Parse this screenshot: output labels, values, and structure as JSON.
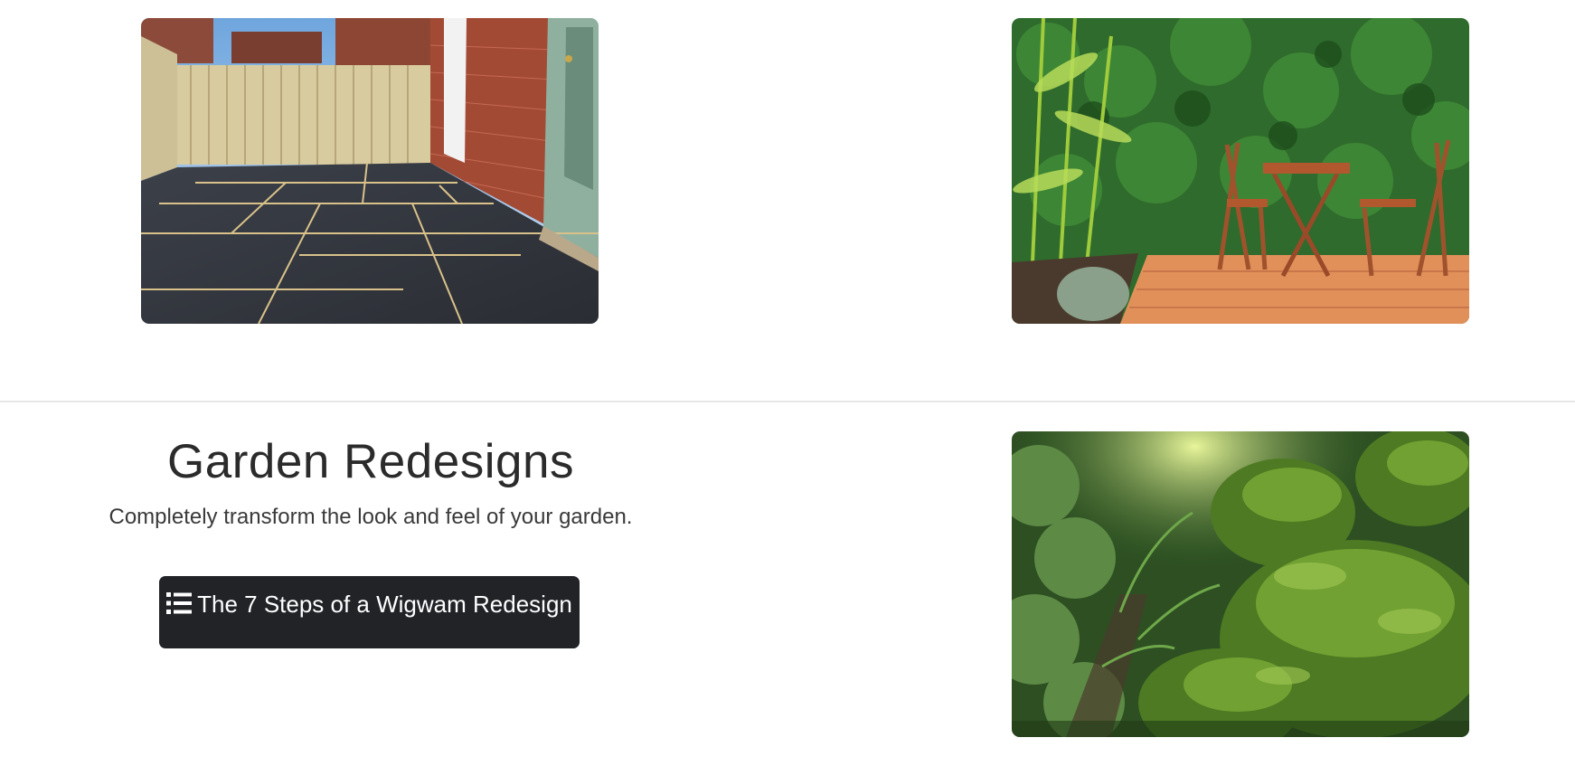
{
  "section": {
    "title": "Garden Redesigns",
    "subtitle": "Completely transform the look and feel of your garden.",
    "button_label": "The 7 Steps of a Wigwam Redesign",
    "button_icon": "list-icon"
  },
  "images": [
    {
      "name": "patio-image",
      "depicts": "patio-image"
    },
    {
      "name": "bistro-deck-image",
      "depicts": "bistro-deck-image"
    },
    {
      "name": "moss-garden-image",
      "depicts": "moss-garden-image"
    }
  ],
  "colors": {
    "button_bg": "#212327",
    "button_text": "#ffffff",
    "divider": "#e6e6e6",
    "heading": "#2b2b2b"
  }
}
